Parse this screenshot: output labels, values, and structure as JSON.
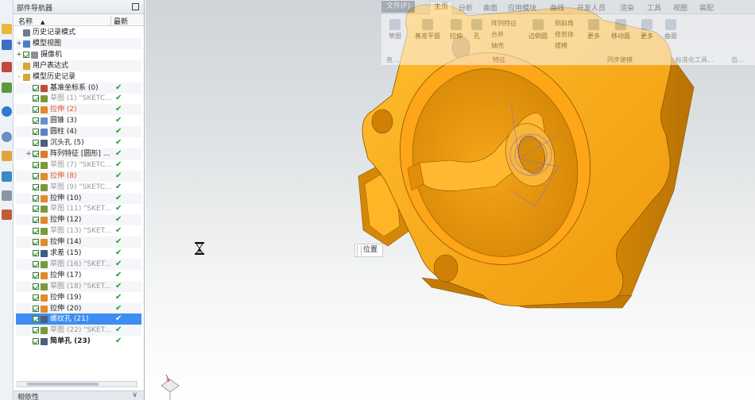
{
  "navigator": {
    "title": "部件导航器",
    "col_name": "名称",
    "col_latest": "最新",
    "rows": [
      {
        "expand": "",
        "check": false,
        "icon": "history-icon",
        "color": "#6b7d93",
        "label": "历史记录模式",
        "style": "",
        "ok": ""
      },
      {
        "expand": "+",
        "check": false,
        "icon": "model-view-icon",
        "color": "#4b7fbf",
        "label": "模型视图",
        "style": "",
        "ok": ""
      },
      {
        "expand": "+",
        "check": true,
        "icon": "camera-icon",
        "color": "#8a8f99",
        "label": "摄像机",
        "style": "",
        "ok": ""
      },
      {
        "expand": "",
        "check": false,
        "icon": "expression-icon",
        "color": "#d9a53a",
        "label": "用户表达式",
        "style": "",
        "ok": ""
      },
      {
        "expand": "-",
        "check": false,
        "icon": "folder-icon",
        "color": "#d9a53a",
        "label": "模型历史记录",
        "style": "",
        "ok": ""
      },
      {
        "expand": "",
        "check": true,
        "icon": "datum-csys-icon",
        "color": "#c04a3a",
        "label": "基准坐标系 (0)",
        "style": "",
        "ok": "✔"
      },
      {
        "expand": "",
        "check": true,
        "icon": "sketch-icon",
        "color": "#7a9a3a",
        "label": "草图 (1) \"SKETC...",
        "style": "gray",
        "ok": "✔"
      },
      {
        "expand": "",
        "check": true,
        "icon": "extrude-icon",
        "color": "#e2892a",
        "label": "拉伸 (2)",
        "style": "red",
        "ok": "✔"
      },
      {
        "expand": "",
        "check": true,
        "icon": "cone-icon",
        "color": "#6a8fd0",
        "label": "圆锥 (3)",
        "style": "",
        "ok": "✔"
      },
      {
        "expand": "",
        "check": true,
        "icon": "cylinder-icon",
        "color": "#5c7fc2",
        "label": "圆柱 (4)",
        "style": "",
        "ok": "✔"
      },
      {
        "expand": "",
        "check": true,
        "icon": "counterbore-icon",
        "color": "#4d5f80",
        "label": "沉头孔 (5)",
        "style": "",
        "ok": "✔"
      },
      {
        "expand": "+",
        "check": true,
        "icon": "pattern-icon",
        "color": "#d97b2a",
        "label": "阵列特征 [圆形] ...",
        "style": "",
        "ok": "✔"
      },
      {
        "expand": "",
        "check": true,
        "icon": "sketch-icon",
        "color": "#7a9a3a",
        "label": "草图 (7) \"SKETC...",
        "style": "gray",
        "ok": "✔"
      },
      {
        "expand": "",
        "check": true,
        "icon": "extrude-icon",
        "color": "#e2892a",
        "label": "拉伸 (8)",
        "style": "red",
        "ok": "✔"
      },
      {
        "expand": "",
        "check": true,
        "icon": "sketch-icon",
        "color": "#7a9a3a",
        "label": "草图 (9) \"SKETC...",
        "style": "gray",
        "ok": "✔"
      },
      {
        "expand": "",
        "check": true,
        "icon": "extrude-icon",
        "color": "#e2892a",
        "label": "拉伸 (10)",
        "style": "",
        "ok": "✔"
      },
      {
        "expand": "",
        "check": true,
        "icon": "sketch-icon",
        "color": "#7a9a3a",
        "label": "草图 (11) \"SKET...",
        "style": "gray",
        "ok": "✔"
      },
      {
        "expand": "",
        "check": true,
        "icon": "extrude-icon",
        "color": "#e2892a",
        "label": "拉伸 (12)",
        "style": "",
        "ok": "✔"
      },
      {
        "expand": "",
        "check": true,
        "icon": "sketch-icon",
        "color": "#7a9a3a",
        "label": "草图 (13) \"SKET...",
        "style": "gray",
        "ok": "✔"
      },
      {
        "expand": "",
        "check": true,
        "icon": "extrude-icon",
        "color": "#e2892a",
        "label": "拉伸 (14)",
        "style": "",
        "ok": "✔"
      },
      {
        "expand": "",
        "check": true,
        "icon": "subtract-icon",
        "color": "#3f5a85",
        "label": "求差 (15)",
        "style": "",
        "ok": "✔"
      },
      {
        "expand": "",
        "check": true,
        "icon": "sketch-icon",
        "color": "#7a9a3a",
        "label": "草图 (16) \"SKET...",
        "style": "gray",
        "ok": "✔"
      },
      {
        "expand": "",
        "check": true,
        "icon": "extrude-icon",
        "color": "#e2892a",
        "label": "拉伸 (17)",
        "style": "",
        "ok": "✔"
      },
      {
        "expand": "",
        "check": true,
        "icon": "sketch-icon",
        "color": "#7a9a3a",
        "label": "草图 (18) \"SKET...",
        "style": "gray",
        "ok": "✔"
      },
      {
        "expand": "",
        "check": true,
        "icon": "extrude-icon",
        "color": "#e2892a",
        "label": "拉伸 (19)",
        "style": "",
        "ok": "✔"
      },
      {
        "expand": "",
        "check": true,
        "icon": "extrude-icon",
        "color": "#e2892a",
        "label": "拉伸 (20)",
        "style": "",
        "ok": "✔"
      },
      {
        "expand": "",
        "check": true,
        "icon": "threaded-hole-icon",
        "color": "#4d5f80",
        "label": "螺纹孔 (21)",
        "style": "sel",
        "ok": "✔"
      },
      {
        "expand": "",
        "check": true,
        "icon": "sketch-icon",
        "color": "#7a9a3a",
        "label": "草图 (22) \"SKET...",
        "style": "gray",
        "ok": "✔"
      },
      {
        "expand": "",
        "check": true,
        "icon": "simple-hole-icon",
        "color": "#4d5f80",
        "label": "简单孔 (23)",
        "style": "bold",
        "ok": "✔"
      }
    ],
    "dependencies": "相依性"
  },
  "ribbon": {
    "tabs": [
      "文件(F)",
      "主页",
      "分析",
      "曲面",
      "应用模块",
      "曲线",
      "开发人员",
      "渲染",
      "工具",
      "视图",
      "装配"
    ],
    "buttons": [
      "草图",
      "基准平面",
      "拉伸",
      "孔",
      "边倒圆",
      "更多",
      "移动面",
      "更多",
      "曲面"
    ],
    "small": [
      "阵列特征",
      "合并",
      "抽壳",
      "倒斜角",
      "修剪体",
      "拔模"
    ],
    "groups": [
      "直...",
      "特征",
      "同步建模",
      "标准化工具...",
      "齿..."
    ]
  },
  "graphics": {
    "position_label": "位置"
  },
  "colors": {
    "part": "#f2a516",
    "part_dark": "#c27a05",
    "part_light": "#ffc94a",
    "selection": "#3d8ef0",
    "check": "#1fa02a"
  }
}
